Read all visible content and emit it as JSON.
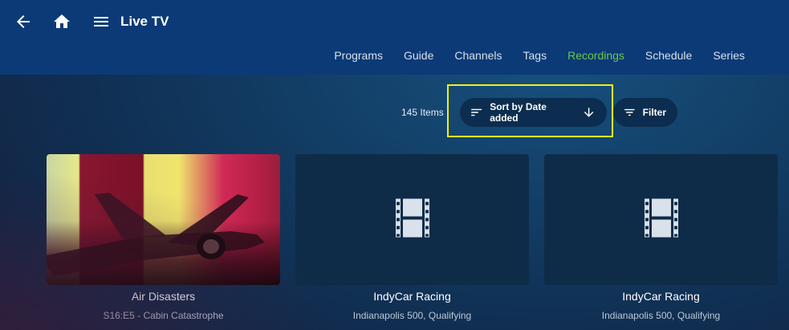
{
  "header": {
    "title": "Live TV",
    "back_icon": "arrow-left-icon",
    "home_icon": "home-icon",
    "menu_icon": "hamburger-menu-icon"
  },
  "tabs": [
    {
      "label": "Programs",
      "active": false
    },
    {
      "label": "Guide",
      "active": false
    },
    {
      "label": "Channels",
      "active": false
    },
    {
      "label": "Tags",
      "active": false
    },
    {
      "label": "Recordings",
      "active": true
    },
    {
      "label": "Schedule",
      "active": false
    },
    {
      "label": "Series",
      "active": false
    }
  ],
  "toolbar": {
    "items_count": "145 Items",
    "sort_label": "Sort by Date added",
    "filter_label": "Filter"
  },
  "cards": [
    {
      "title": "Air Disasters",
      "subtitle": "S16:E5 - Cabin Catastrophe",
      "has_image": true
    },
    {
      "title": "IndyCar Racing",
      "subtitle": "Indianapolis 500, Qualifying",
      "has_image": false
    },
    {
      "title": "IndyCar Racing",
      "subtitle": "Indianapolis 500, Qualifying",
      "has_image": false
    }
  ],
  "colors": {
    "header_bg": "#0b3a77",
    "active_tab": "#6bc84a",
    "highlight_box": "#f2ef1e",
    "pill_bg": "#0c2d4f"
  }
}
